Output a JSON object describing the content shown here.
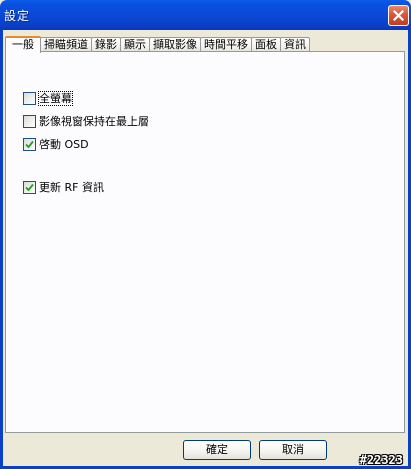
{
  "window": {
    "title": "設定",
    "close_icon": "close-icon"
  },
  "tabs": [
    {
      "label": "一般",
      "active": true
    },
    {
      "label": "掃瞄頻道",
      "active": false
    },
    {
      "label": "錄影",
      "active": false
    },
    {
      "label": "顯示",
      "active": false
    },
    {
      "label": "擷取影像",
      "active": false
    },
    {
      "label": "時間平移",
      "active": false
    },
    {
      "label": "面板",
      "active": false
    },
    {
      "label": "資訊",
      "active": false
    }
  ],
  "options": [
    {
      "label": "全螢幕",
      "checked": false
    },
    {
      "label": "影像視窗保持在最上層",
      "checked": false
    },
    {
      "label": "啓動 OSD",
      "checked": true
    },
    {
      "label": "更新 RF 資訊",
      "checked": true
    }
  ],
  "buttons": {
    "ok_label": "確定",
    "cancel_label": "取消"
  },
  "watermark": "#22323",
  "colors": {
    "titlebar": "#0a4fe0",
    "close_button": "#d9573a",
    "active_tab_accent": "#e68b2c",
    "check_mark": "#21a121"
  }
}
